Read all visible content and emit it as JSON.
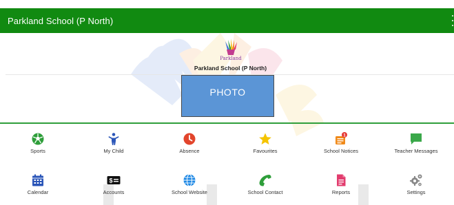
{
  "appbar": {
    "title": "Parkland School (P North)",
    "color": "#118a11"
  },
  "school": {
    "logo_text": "Parkland",
    "name": "Parkland School (P North)"
  },
  "photo": {
    "label": "PHOTO",
    "color": "#5b95d6"
  },
  "menu": [
    {
      "label": "Sports",
      "icon": "soccer-ball-icon",
      "color": "#2e9e3a"
    },
    {
      "label": "My Child",
      "icon": "child-icon",
      "color": "#2a55b8"
    },
    {
      "label": "Absence",
      "icon": "clock-icon",
      "color": "#e2452c"
    },
    {
      "label": "Favourites",
      "icon": "star-icon",
      "color": "#f5c400"
    },
    {
      "label": "School Notices",
      "icon": "notices-icon",
      "color": "#f08a1a",
      "badge": "1"
    },
    {
      "label": "Teacher Messages",
      "icon": "chat-icon",
      "color": "#3aa84a"
    },
    {
      "label": "Calendar",
      "icon": "calendar-icon",
      "color": "#2a55b8"
    },
    {
      "label": "Accounts",
      "icon": "money-icon",
      "color": "#111111"
    },
    {
      "label": "School Website",
      "icon": "globe-icon",
      "color": "#1e88e5"
    },
    {
      "label": "School Contact",
      "icon": "phone-icon",
      "color": "#2e9e3a"
    },
    {
      "label": "Reports",
      "icon": "report-icon",
      "color": "#e23c6e"
    },
    {
      "label": "Settings",
      "icon": "gears-icon",
      "color": "#888888"
    }
  ]
}
